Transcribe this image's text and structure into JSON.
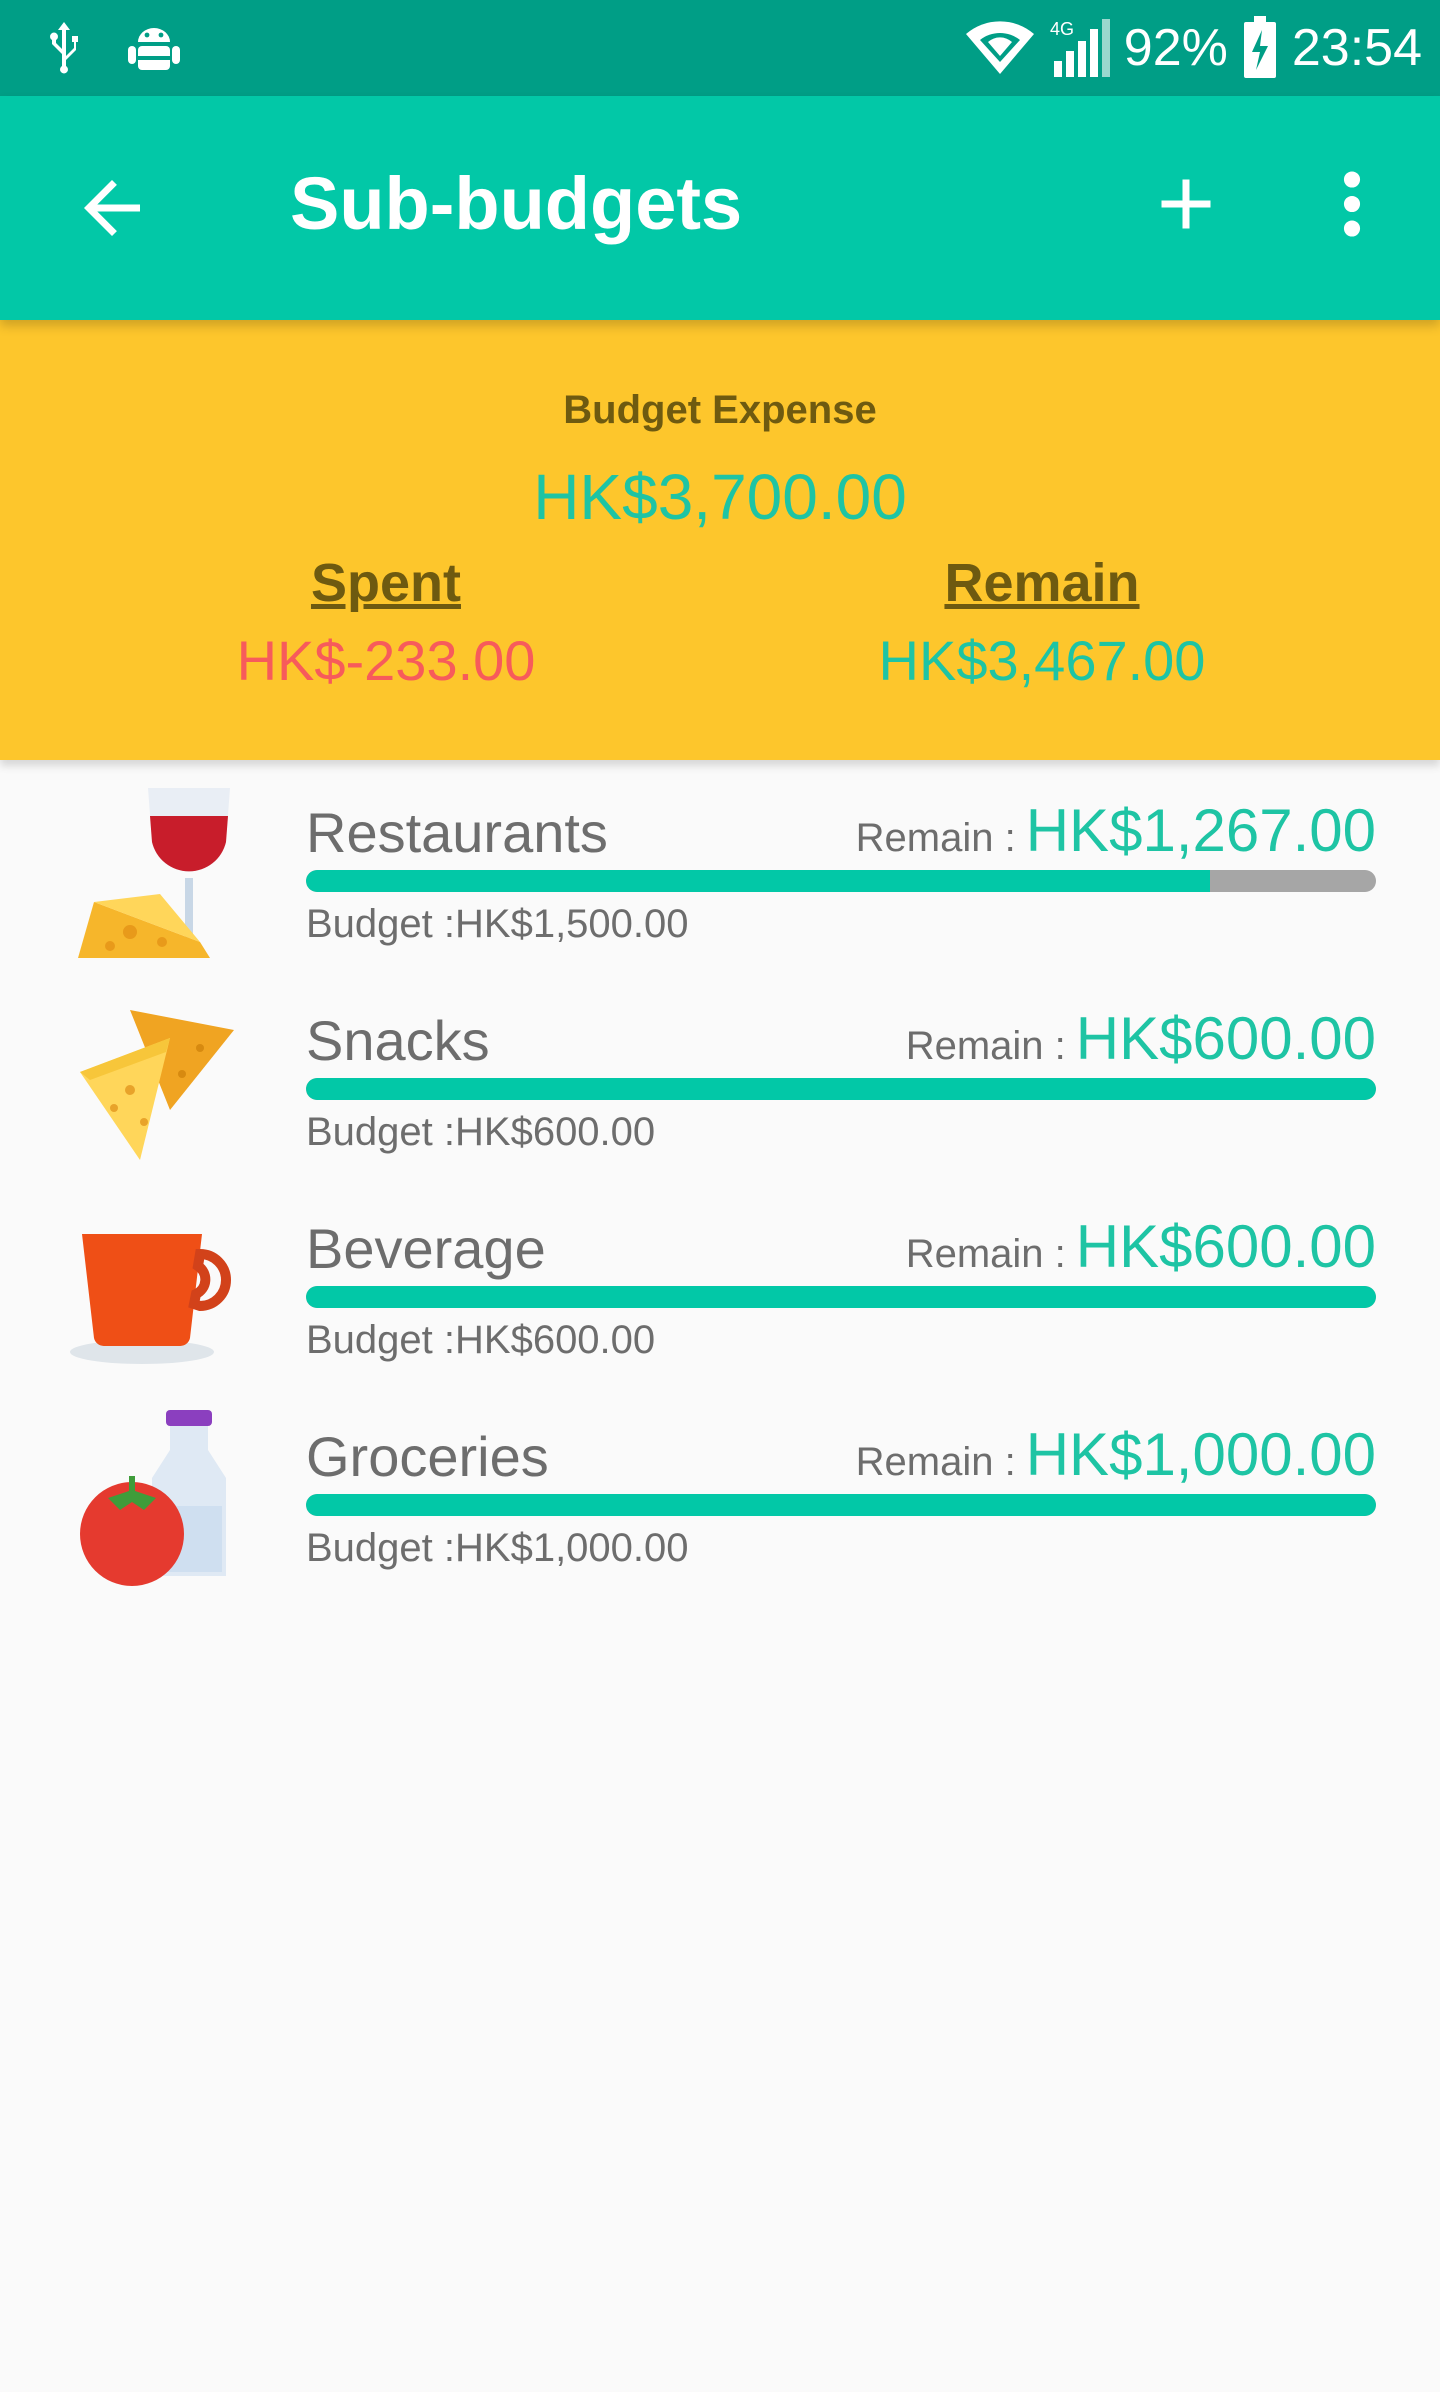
{
  "status_bar": {
    "battery": "92%",
    "time": "23:54",
    "icons": [
      "usb-icon",
      "android-debug-icon",
      "wifi-icon",
      "signal-4g-icon",
      "battery-charging-icon"
    ],
    "network_type": "4G"
  },
  "appbar": {
    "title": "Sub-budgets",
    "color": "#02c8a7",
    "icons": [
      "back-arrow-icon",
      "add-icon",
      "more-vert-icon"
    ]
  },
  "summary": {
    "label": "Budget Expense",
    "total": "HK$3,700.00",
    "spent_label": "Spent",
    "spent_value": "HK$-233.00",
    "remain_label": "Remain",
    "remain_value": "HK$3,467.00",
    "background": "#fdc62c"
  },
  "items": [
    {
      "name": "Restaurants",
      "remain_label": "Remain :",
      "remain_value": "HK$1,267.00",
      "budget": "Budget :HK$1,500.00",
      "progress": 0.8447,
      "icon": "wine-cheese-icon"
    },
    {
      "name": "Snacks",
      "remain_label": "Remain :",
      "remain_value": "HK$600.00",
      "budget": "Budget :HK$600.00",
      "progress": 1.0,
      "icon": "nachos-icon"
    },
    {
      "name": "Beverage",
      "remain_label": "Remain :",
      "remain_value": "HK$600.00",
      "budget": "Budget :HK$600.00",
      "progress": 1.0,
      "icon": "coffee-cup-icon"
    },
    {
      "name": "Groceries",
      "remain_label": "Remain :",
      "remain_value": "HK$1,000.00",
      "budget": "Budget :HK$1,000.00",
      "progress": 1.0,
      "icon": "tomato-bottle-icon"
    }
  ]
}
